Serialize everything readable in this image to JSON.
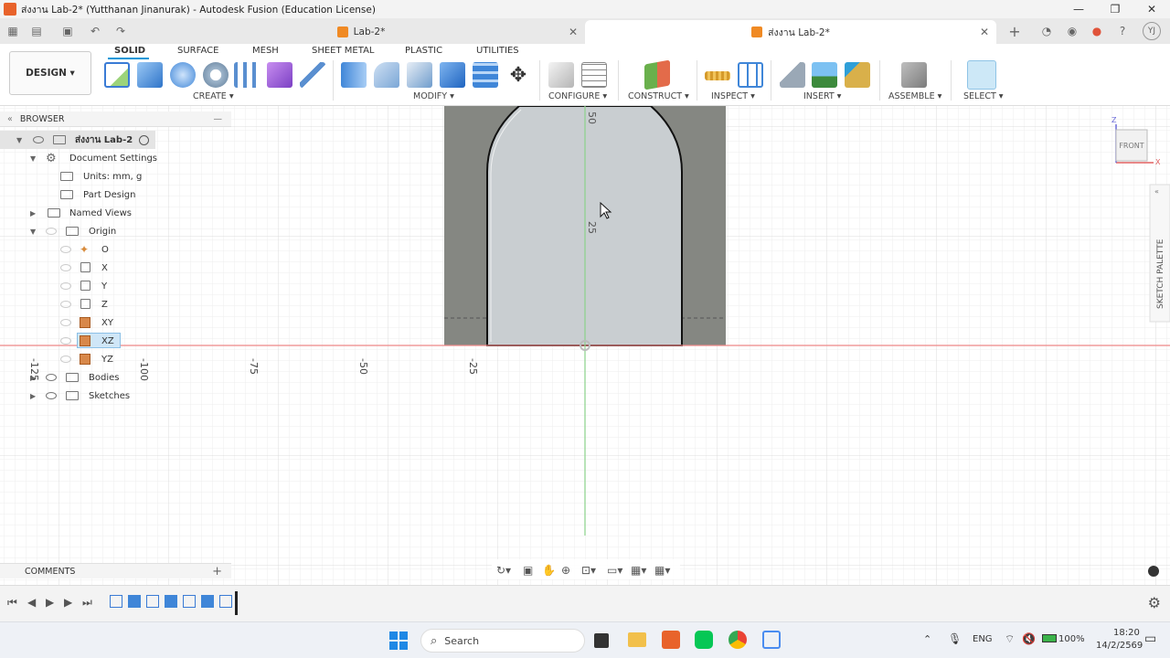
{
  "window": {
    "title": "ส่งงาน Lab-2* (Yutthanan Jinanurak) - Autodesk Fusion (Education License)"
  },
  "tabs": [
    {
      "label": "Lab-2*",
      "active": false
    },
    {
      "label": "ส่งงาน Lab-2*",
      "active": true
    }
  ],
  "user": {
    "initials": "YJ"
  },
  "toolbar": {
    "workspace": "DESIGN ▾",
    "tabs": [
      "SOLID",
      "SURFACE",
      "MESH",
      "SHEET METAL",
      "PLASTIC",
      "UTILITIES"
    ],
    "groups": {
      "create": "CREATE ▾",
      "modify": "MODIFY ▾",
      "configure": "CONFIGURE ▾",
      "construct": "CONSTRUCT ▾",
      "inspect": "INSPECT ▾",
      "insert": "INSERT ▾",
      "assemble": "ASSEMBLE ▾",
      "select": "SELECT ▾"
    }
  },
  "browser": {
    "title": "BROWSER",
    "root": "ส่งงาน Lab-2",
    "document_settings": "Document Settings",
    "units": "Units: mm, g",
    "part_design": "Part Design",
    "named_views": "Named Views",
    "origin": "Origin",
    "origin_items": [
      "O",
      "X",
      "Y",
      "Z",
      "XY",
      "XZ",
      "YZ"
    ],
    "bodies": "Bodies",
    "sketches": "Sketches"
  },
  "comments": {
    "title": "COMMENTS"
  },
  "viewport": {
    "viewcube": "FRONT",
    "axis_z": "Z",
    "axis_x": "X",
    "sketch_palette": "SKETCH PALETTE",
    "ruler_x": [
      "-125",
      "-100",
      "-75",
      "-50",
      "-25"
    ],
    "ruler_y": [
      "50",
      "25"
    ]
  },
  "taskbar": {
    "search": "Search",
    "lang": "ENG",
    "battery": "100%",
    "time": "18:20",
    "date": "14/2/2569"
  }
}
